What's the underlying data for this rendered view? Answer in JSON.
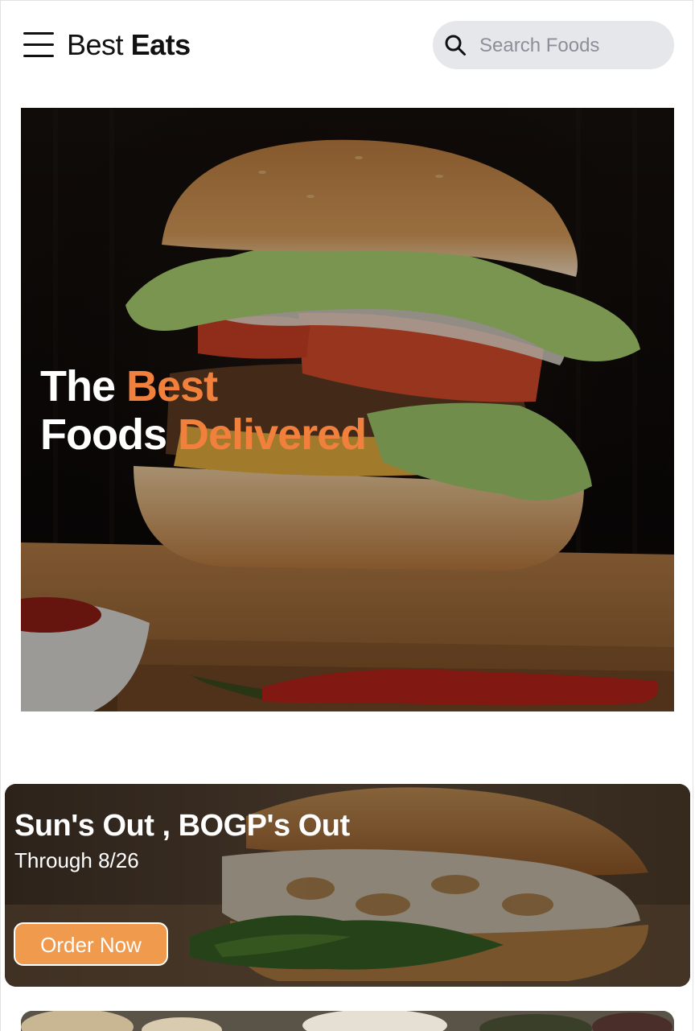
{
  "header": {
    "brand_regular": "Best",
    "brand_bold": "Eats",
    "search_placeholder": "Search Foods",
    "menu_icon": "hamburger-menu-icon",
    "search_icon": "search-icon"
  },
  "hero": {
    "line1_white": "The",
    "line1_accent": "Best",
    "line2_white": "Foods",
    "line2_accent": "Delivered",
    "image": "burger-photo",
    "accent_color": "#f0803c"
  },
  "promo": {
    "title": "Sun's Out , BOGP's Out",
    "subtitle": "Through 8/26",
    "button_label": "Order Now",
    "image": "sandwich-photo",
    "button_color": "#ef9a4c"
  },
  "next_card": {
    "image": "food-platter-photo"
  }
}
